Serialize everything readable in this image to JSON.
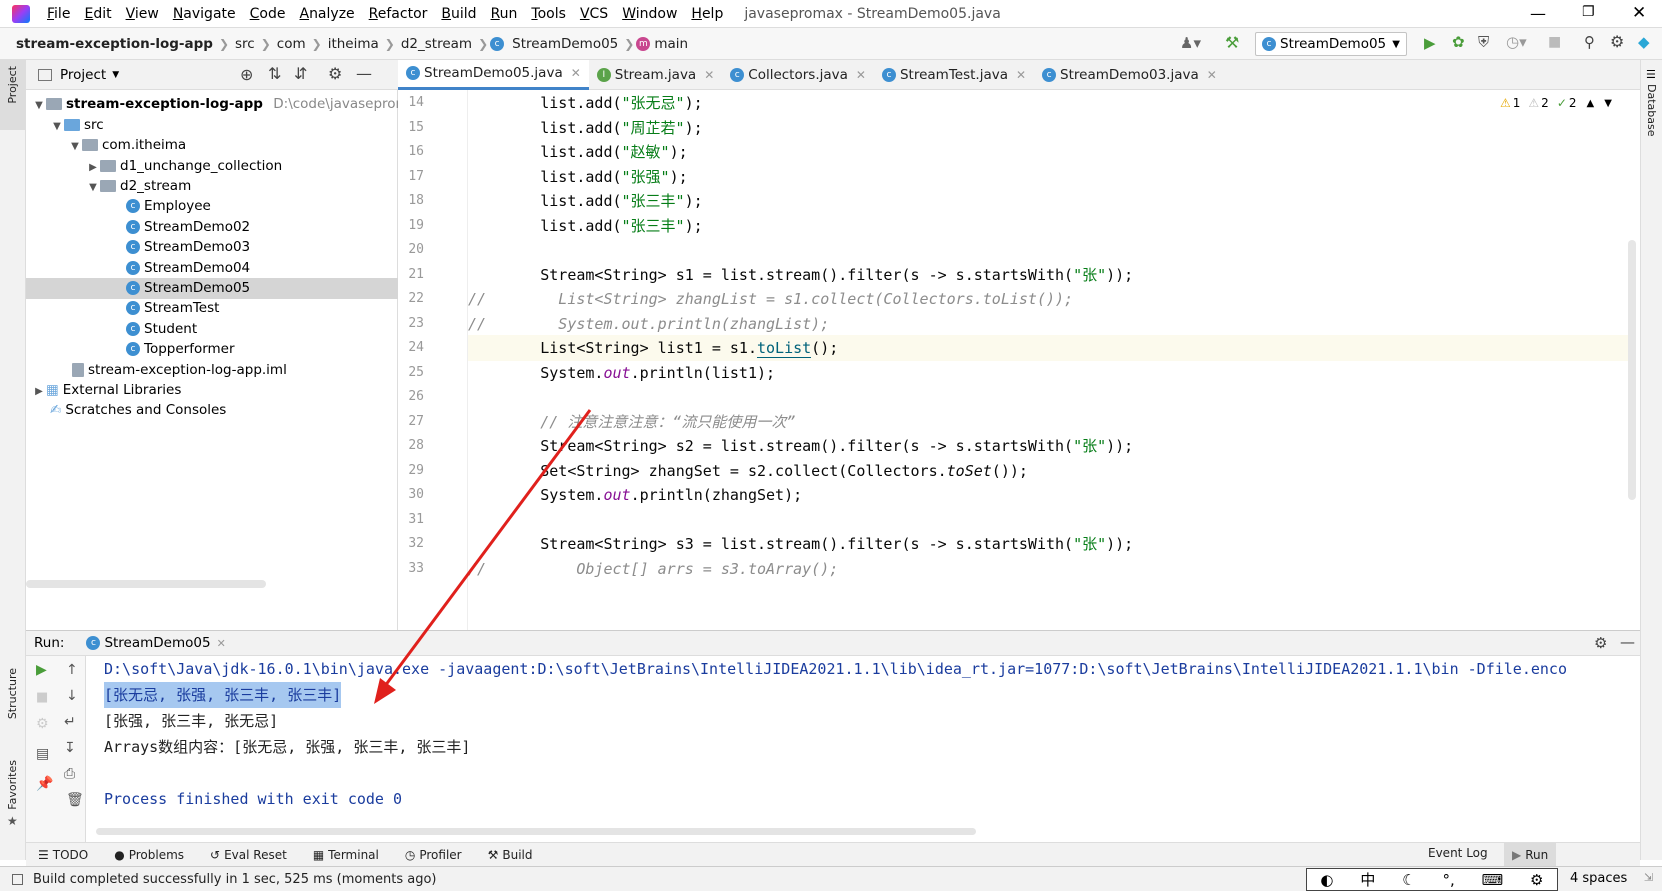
{
  "menu": {
    "items": [
      "File",
      "Edit",
      "View",
      "Navigate",
      "Code",
      "Analyze",
      "Refactor",
      "Build",
      "Run",
      "Tools",
      "VCS",
      "Window",
      "Help"
    ],
    "title": "javasepromax - StreamDemo05.java"
  },
  "breadcrumb": {
    "project": "stream-exception-log-app",
    "items": [
      "src",
      "com",
      "itheima",
      "d2_stream",
      "StreamDemo05",
      "main"
    ]
  },
  "toolbar": {
    "run_config": "StreamDemo05"
  },
  "project": {
    "header": "Project",
    "root": "stream-exception-log-app",
    "root_path": "D:\\code\\javasepromax",
    "src": "src",
    "pkg": "com.itheima",
    "folder1": "d1_unchange_collection",
    "folder2": "d2_stream",
    "classes": [
      "Employee",
      "StreamDemo02",
      "StreamDemo03",
      "StreamDemo04",
      "StreamDemo05",
      "StreamTest",
      "Student",
      "Topperformer"
    ],
    "iml": "stream-exception-log-app.iml",
    "ext": "External Libraries",
    "scratch": "Scratches and Consoles"
  },
  "tabs": [
    "StreamDemo05.java",
    "Stream.java",
    "Collectors.java",
    "StreamTest.java",
    "StreamDemo03.java"
  ],
  "inspections": {
    "warn1": "1",
    "warn2": "2",
    "ok": "2"
  },
  "editor": {
    "lines": [
      {
        "n": "14",
        "t": "        list.add(\"张无忌\");"
      },
      {
        "n": "15",
        "t": "        list.add(\"周芷若\");"
      },
      {
        "n": "16",
        "t": "        list.add(\"赵敏\");"
      },
      {
        "n": "17",
        "t": "        list.add(\"张强\");"
      },
      {
        "n": "18",
        "t": "        list.add(\"张三丰\");"
      },
      {
        "n": "19",
        "t": "        list.add(\"张三丰\");"
      },
      {
        "n": "20",
        "t": ""
      },
      {
        "n": "21",
        "t": "        Stream<String> s1 = list.stream().filter(s -> s.startsWith(\"张\"));"
      },
      {
        "n": "22",
        "t": "//        List<String> zhangList = s1.collect(Collectors.toList());"
      },
      {
        "n": "23",
        "t": "//        System.out.println(zhangList);"
      },
      {
        "n": "24",
        "t": "        List<String> list1 = s1.toList();"
      },
      {
        "n": "25",
        "t": "        System.out.println(list1);"
      },
      {
        "n": "26",
        "t": ""
      },
      {
        "n": "27",
        "t": "        // 注意注意注意：“流只能使用一次”"
      },
      {
        "n": "28",
        "t": "        Stream<String> s2 = list.stream().filter(s -> s.startsWith(\"张\"));"
      },
      {
        "n": "29",
        "t": "        Set<String> zhangSet = s2.collect(Collectors.toSet());"
      },
      {
        "n": "30",
        "t": "        System.out.println(zhangSet);"
      },
      {
        "n": "31",
        "t": ""
      },
      {
        "n": "32",
        "t": "        Stream<String> s3 = list.stream().filter(s -> s.startsWith(\"张\"));"
      },
      {
        "n": "33",
        "t": "//          Object[] arrs = s3.toArray();"
      }
    ]
  },
  "run": {
    "label": "Run:",
    "tab": "StreamDemo05",
    "cmd": "D:\\soft\\Java\\jdk-16.0.1\\bin\\java.exe -javaagent:D:\\soft\\JetBrains\\IntelliJIDEA2021.1.1\\lib\\idea_rt.jar=1077:D:\\soft\\JetBrains\\IntelliJIDEA2021.1.1\\bin -Dfile.enco",
    "out1": "[张无忌, 张强, 张三丰, 张三丰]",
    "out2": "[张强, 张三丰, 张无忌]",
    "out3": "Arrays数组内容：[张无忌, 张强, 张三丰, 张三丰]",
    "out4": "Process finished with exit code 0"
  },
  "bottom": {
    "tabs": [
      "TODO",
      "Problems",
      "Eval Reset",
      "Terminal",
      "Profiler",
      "Build"
    ],
    "eventlog": "Event Log",
    "run": "Run"
  },
  "status": {
    "text": "Build completed successfully in 1 sec, 525 ms (moments ago)",
    "indent": "4 spaces",
    "ime": "中"
  },
  "side": {
    "left_top": "Project",
    "left_mid": "Structure",
    "left_bot": "Favorites",
    "right": "Database"
  },
  "colors": {
    "accent": "#4083c9",
    "selection": "#a6c8f0",
    "arrow": "#e0201c"
  }
}
